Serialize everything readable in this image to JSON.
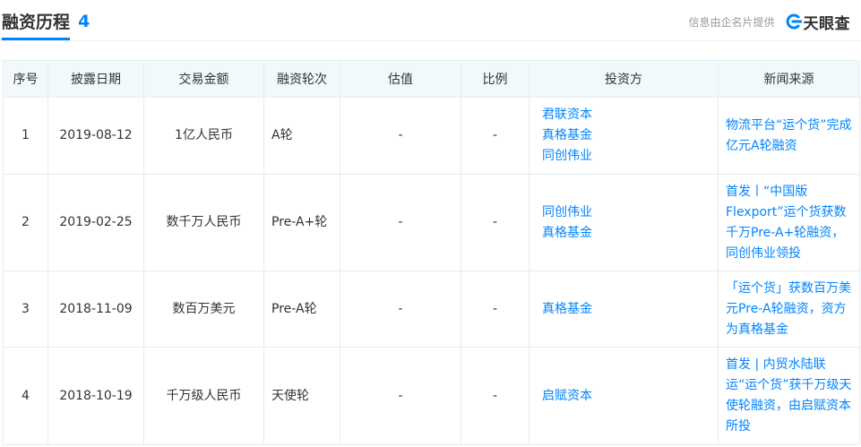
{
  "section": {
    "title": "融资历程",
    "count": "4",
    "provider_text": "信息由企名片提供",
    "logo_text": "天眼查"
  },
  "table": {
    "headers": [
      "序号",
      "披露日期",
      "交易金额",
      "融资轮次",
      "估值",
      "比例",
      "投资方",
      "新闻来源"
    ],
    "rows": [
      {
        "index": "1",
        "date": "2019-08-12",
        "amount": "1亿人民币",
        "round": "A轮",
        "valuation": "-",
        "ratio": "-",
        "investors": [
          "君联资本",
          "真格基金",
          "同创伟业"
        ],
        "news": "物流平台“运个货”完成亿元A轮融资"
      },
      {
        "index": "2",
        "date": "2019-02-25",
        "amount": "数千万人民币",
        "round": "Pre-A+轮",
        "valuation": "-",
        "ratio": "-",
        "investors": [
          "同创伟业",
          "真格基金"
        ],
        "news": "首发丨“中国版Flexport”运个货获数千万Pre-A+轮融资，同创伟业领投"
      },
      {
        "index": "3",
        "date": "2018-11-09",
        "amount": "数百万美元",
        "round": "Pre-A轮",
        "valuation": "-",
        "ratio": "-",
        "investors": [
          "真格基金"
        ],
        "news": "「运个货」获数百万美元Pre-A轮融资，资方为真格基金"
      },
      {
        "index": "4",
        "date": "2018-10-19",
        "amount": "千万级人民币",
        "round": "天使轮",
        "valuation": "-",
        "ratio": "-",
        "investors": [
          "启赋资本"
        ],
        "news": "首发 | 内贸水陆联运“运个货”获千万级天使轮融资，由启赋资本所投"
      }
    ]
  },
  "colors": {
    "accent": "#0084ff",
    "header_bg": "#f2f9fc",
    "border": "#e3edf2",
    "muted": "#999999"
  }
}
